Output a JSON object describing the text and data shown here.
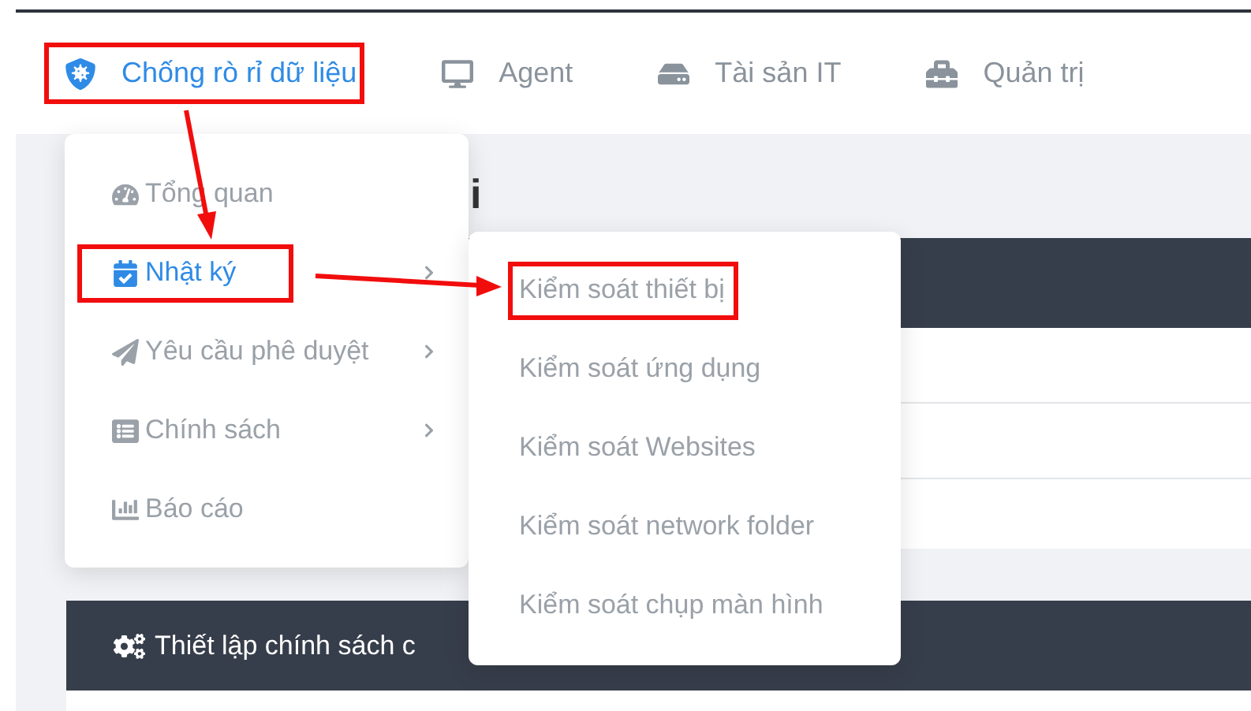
{
  "nav": [
    {
      "label": "Chống rò rỉ dữ liệu",
      "selected": true,
      "highlighted": true
    },
    {
      "label": "Agent",
      "selected": false,
      "highlighted": false
    },
    {
      "label": "Tài sản IT",
      "selected": false,
      "highlighted": false
    },
    {
      "label": "Quản trị",
      "selected": false,
      "highlighted": false
    }
  ],
  "page_title": "i",
  "menu": [
    {
      "label": "Tổng quan",
      "selected": false,
      "has_submenu": false,
      "highlighted": false
    },
    {
      "label": "Nhật ký",
      "selected": true,
      "has_submenu": true,
      "highlighted": true
    },
    {
      "label": "Yêu cầu phê duyệt",
      "selected": false,
      "has_submenu": true,
      "highlighted": false
    },
    {
      "label": "Chính sách",
      "selected": false,
      "has_submenu": true,
      "highlighted": false
    },
    {
      "label": "Báo cáo",
      "selected": false,
      "has_submenu": false,
      "highlighted": false
    }
  ],
  "submenu": [
    {
      "label": "Kiểm soát thiết bị",
      "highlighted": true
    },
    {
      "label": "Kiểm soát ứng dụng",
      "highlighted": false
    },
    {
      "label": "Kiểm soát Websites",
      "highlighted": false
    },
    {
      "label": "Kiểm soát network folder",
      "highlighted": false
    },
    {
      "label": "Kiểm soát chụp màn hình",
      "highlighted": false
    }
  ],
  "policy_card": {
    "title": "Thiết lập chính sách c"
  }
}
